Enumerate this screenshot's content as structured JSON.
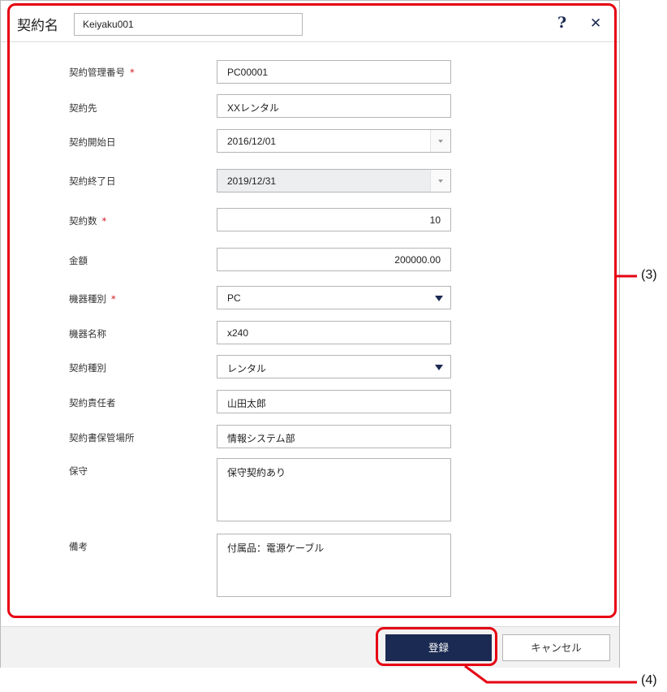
{
  "dialog": {
    "title": "契約名",
    "name_value": "Keiyaku001",
    "help_icon": "?",
    "close_icon": "✕"
  },
  "form": {
    "fields": [
      {
        "label": "契約管理番号",
        "required": true,
        "type": "text",
        "value": "PC00001"
      },
      {
        "label": "契約先",
        "required": false,
        "type": "text",
        "value": "XXレンタル"
      },
      {
        "label": "契約開始日",
        "required": false,
        "type": "date",
        "value": "2016/12/01"
      },
      {
        "label": "契約終了日",
        "required": false,
        "type": "date-disabled",
        "value": "2019/12/31"
      },
      {
        "label": "契約数",
        "required": true,
        "type": "number",
        "value": "10"
      },
      {
        "label": "金額",
        "required": false,
        "type": "number",
        "value": "200000.00"
      },
      {
        "label": "機器種別",
        "required": true,
        "type": "select",
        "value": "PC"
      },
      {
        "label": "機器名称",
        "required": false,
        "type": "text",
        "value": "x240"
      },
      {
        "label": "契約種別",
        "required": false,
        "type": "select",
        "value": "レンタル"
      },
      {
        "label": "契約責任者",
        "required": false,
        "type": "text",
        "value": "山田太郎"
      },
      {
        "label": "契約書保管場所",
        "required": false,
        "type": "text",
        "value": "情報システム部"
      },
      {
        "label": "保守",
        "required": false,
        "type": "textarea",
        "value": "保守契約あり"
      },
      {
        "label": "備考",
        "required": false,
        "type": "textarea",
        "value": "付属品：電源ケーブル"
      }
    ],
    "required_mark": "*"
  },
  "footer": {
    "register_label": "登録",
    "cancel_label": "キャンセル"
  },
  "annotations": {
    "callout_3": "(3)",
    "callout_4": "(4)",
    "color": "#e60012"
  }
}
